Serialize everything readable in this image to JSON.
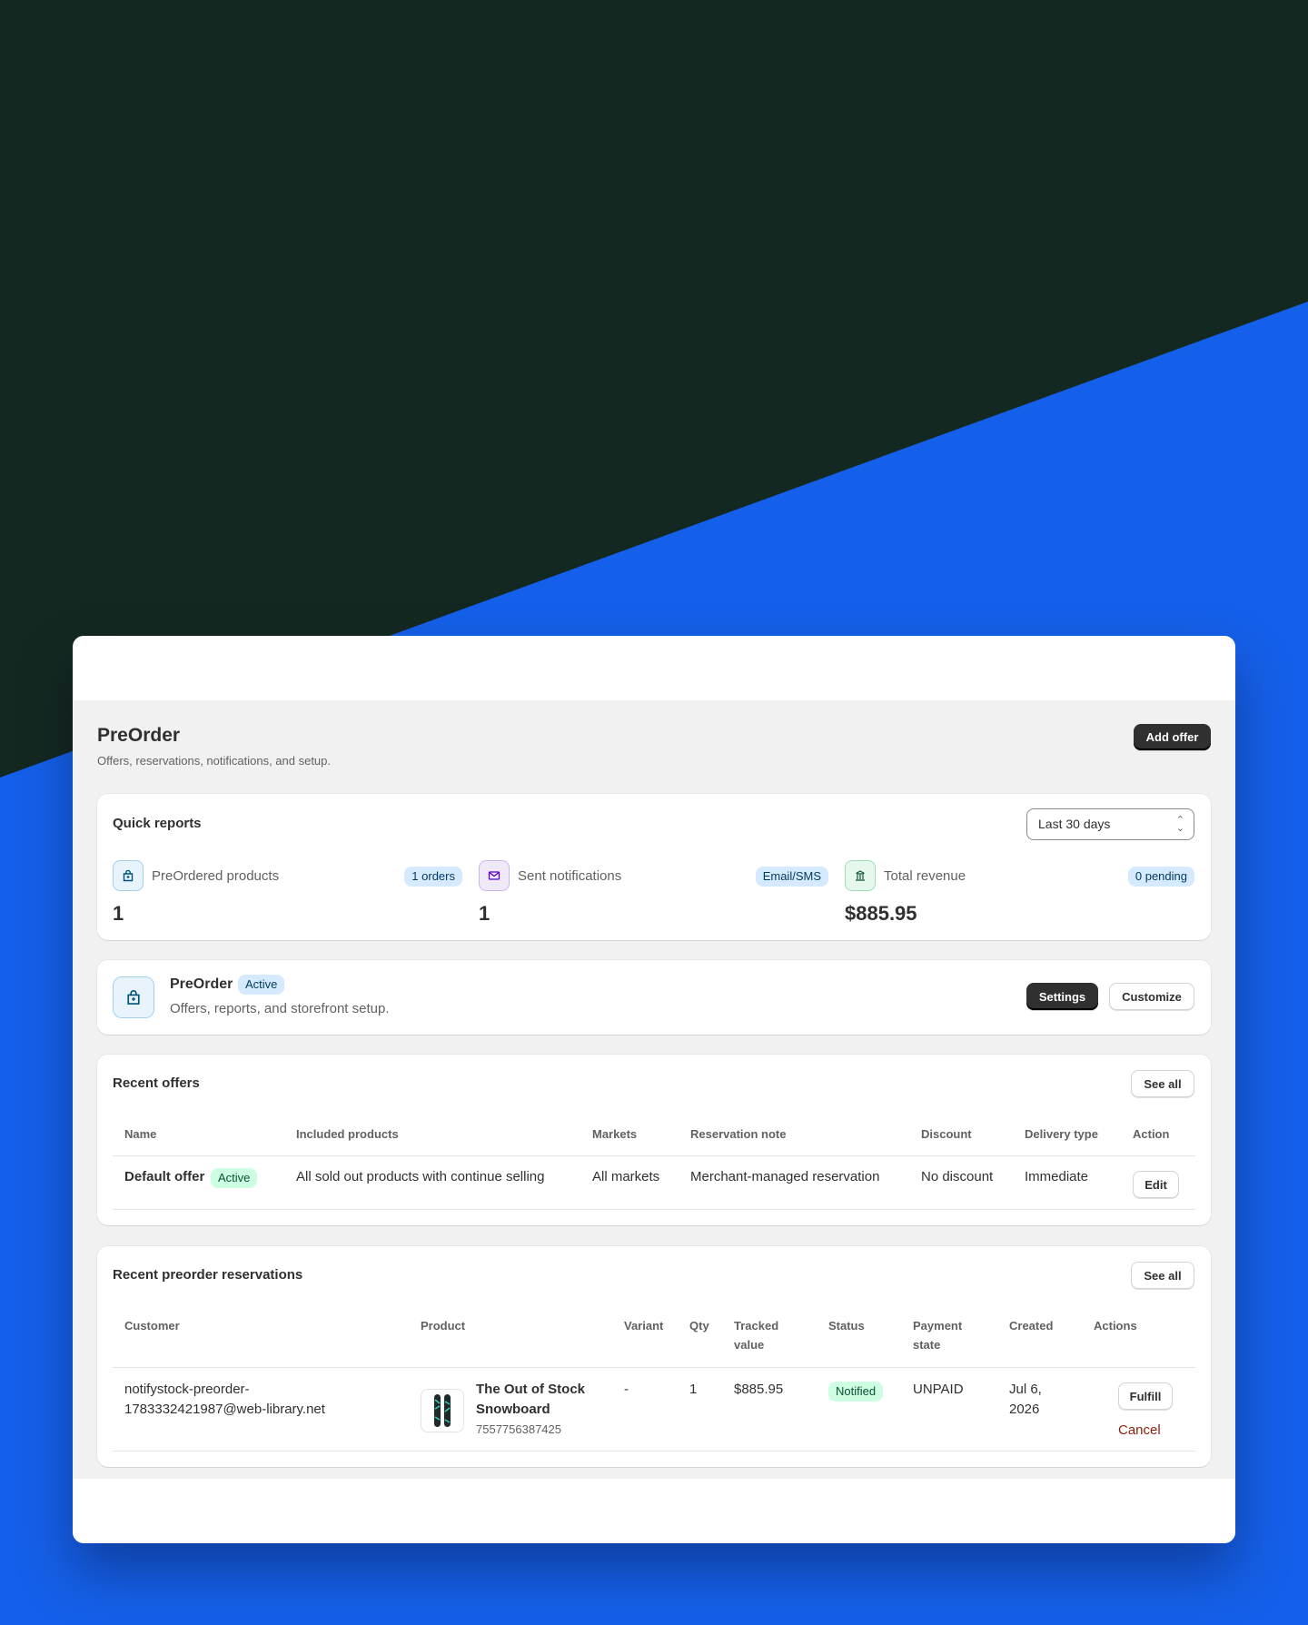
{
  "header": {
    "title": "PreOrder",
    "subtitle": "Offers, reservations, notifications, and setup.",
    "add_offer_label": "Add offer"
  },
  "quick_reports": {
    "title": "Quick reports",
    "range_select": "Last 30 days",
    "metrics": [
      {
        "icon": "shopping-bag-icon",
        "label": "PreOrdered products",
        "badge": "1 orders",
        "value": "1"
      },
      {
        "icon": "envelope-icon",
        "label": "Sent notifications",
        "badge": "Email/SMS",
        "value": "1"
      },
      {
        "icon": "bank-icon",
        "label": "Total revenue",
        "badge": "0 pending",
        "value": "$885.95"
      }
    ]
  },
  "app_card": {
    "name": "PreOrder",
    "status": "Active",
    "description": "Offers, reports, and storefront setup.",
    "settings_label": "Settings",
    "customize_label": "Customize"
  },
  "recent_offers": {
    "title": "Recent offers",
    "see_all_label": "See all",
    "headers": [
      "Name",
      "Included products",
      "Markets",
      "Reservation note",
      "Discount",
      "Delivery type",
      "Action"
    ],
    "rows": [
      {
        "name": "Default offer",
        "status": "Active",
        "included_products": "All sold out products with continue selling",
        "markets": "All markets",
        "reservation_note": "Merchant-managed reservation",
        "discount": "No discount",
        "delivery_type": "Immediate",
        "action_label": "Edit"
      }
    ]
  },
  "recent_reservations": {
    "title": "Recent preorder reservations",
    "see_all_label": "See all",
    "headers": {
      "customer": "Customer",
      "product": "Product",
      "variant": "Variant",
      "qty": "Qty",
      "tracked_value_1": "Tracked",
      "tracked_value_2": "value",
      "status": "Status",
      "payment_1": "Payment",
      "payment_2": "state",
      "created": "Created",
      "actions": "Actions"
    },
    "rows": [
      {
        "customer_line1": "notifystock-preorder-",
        "customer_line2": "1783332421987@web-library.net",
        "product_name_line1": "The Out of Stock",
        "product_name_line2": "Snowboard",
        "product_id": "7557756387425",
        "variant": "-",
        "qty": "1",
        "tracked_value": "$885.95",
        "status": "Notified",
        "payment_state": "UNPAID",
        "created_line1": "Jul 6,",
        "created_line2": "2026",
        "fulfill_label": "Fulfill",
        "cancel_label": "Cancel"
      }
    ]
  },
  "colors": {
    "background_dark": "#142822",
    "background_blue": "#1560ea",
    "badge_info": "#d6eaff",
    "badge_success": "#cdfee1",
    "critical_text": "#8e1f0b"
  }
}
